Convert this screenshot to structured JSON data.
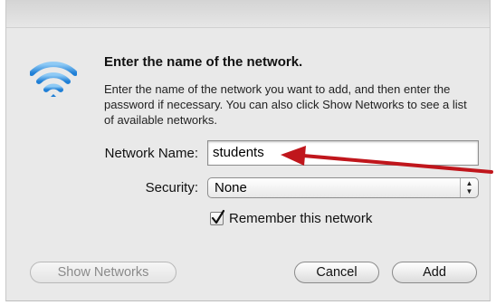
{
  "dialog": {
    "title": "Enter the name of the network.",
    "description": "Enter the name of the network you want to add, and then enter the password if necessary. You can also click Show Networks to see a list of available networks."
  },
  "form": {
    "network_name_label": "Network Name:",
    "network_name_value": "students",
    "security_label": "Security:",
    "security_value": "None",
    "remember_label": "Remember this network",
    "remember_checked": true
  },
  "buttons": {
    "show_networks": "Show Networks",
    "cancel": "Cancel",
    "add": "Add"
  },
  "icons": {
    "wifi": "wifi-icon",
    "popup_arrows": "updown-arrows-icon",
    "checkmark": "checkmark-icon",
    "annotation_arrow": "red-arrow-icon"
  },
  "colors": {
    "wifi_blue": "#2e8fe0",
    "annotation_red": "#c0161c"
  }
}
